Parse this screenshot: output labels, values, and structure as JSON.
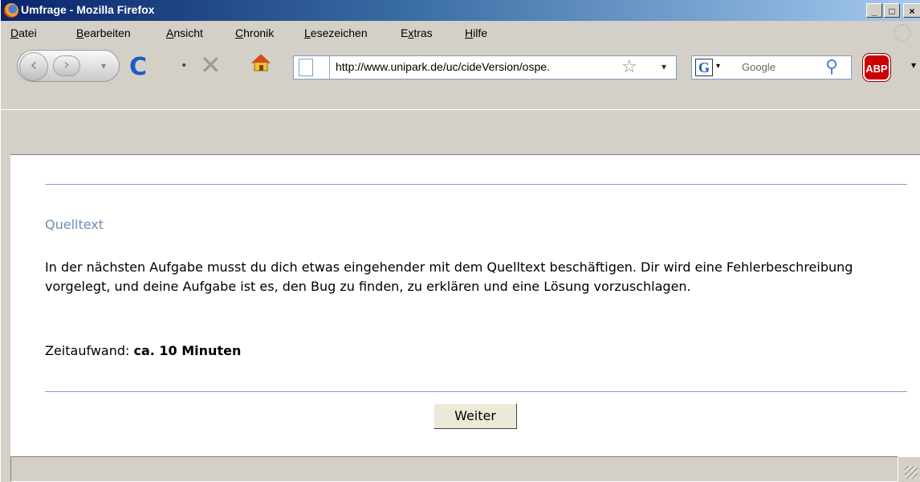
{
  "window": {
    "title": "Umfrage - Mozilla Firefox",
    "controls": {
      "minimize": "_",
      "maximize": "□",
      "close": "×"
    }
  },
  "menu": {
    "items": [
      {
        "pre": "",
        "key": "D",
        "post": "atei"
      },
      {
        "pre": "",
        "key": "B",
        "post": "earbeiten"
      },
      {
        "pre": "",
        "key": "A",
        "post": "nsicht"
      },
      {
        "pre": "",
        "key": "C",
        "post": "hronik"
      },
      {
        "pre": "",
        "key": "L",
        "post": "esezeichen"
      },
      {
        "pre": "E",
        "key": "x",
        "post": "tras"
      },
      {
        "pre": "",
        "key": "H",
        "post": "ilfe"
      }
    ]
  },
  "toolbar": {
    "url": "http://www.unipark.de/uc/cideVersion/ospe.",
    "search_placeholder": "Google",
    "search_engine_letter": "G",
    "adblock_label": "ABP",
    "icons": [
      "back-icon",
      "forward-icon",
      "reload-icon",
      "stop-icon",
      "home-icon",
      "page-icon",
      "bookmark-star-icon",
      "search-icon",
      "adblock-icon"
    ]
  },
  "page": {
    "heading": "Quelltext",
    "body": "In der nächsten Aufgabe musst du dich etwas eingehender mit dem Quelltext beschäftigen. Dir wird eine Fehlerbeschreibung vorgelegt, und deine Aufgabe ist es, den Bug zu finden, zu erklären und eine Lösung vorzuschlagen.",
    "time_label": "Zeitaufwand: ",
    "time_value": "ca. 10 Minuten",
    "next_button": "Weiter"
  }
}
